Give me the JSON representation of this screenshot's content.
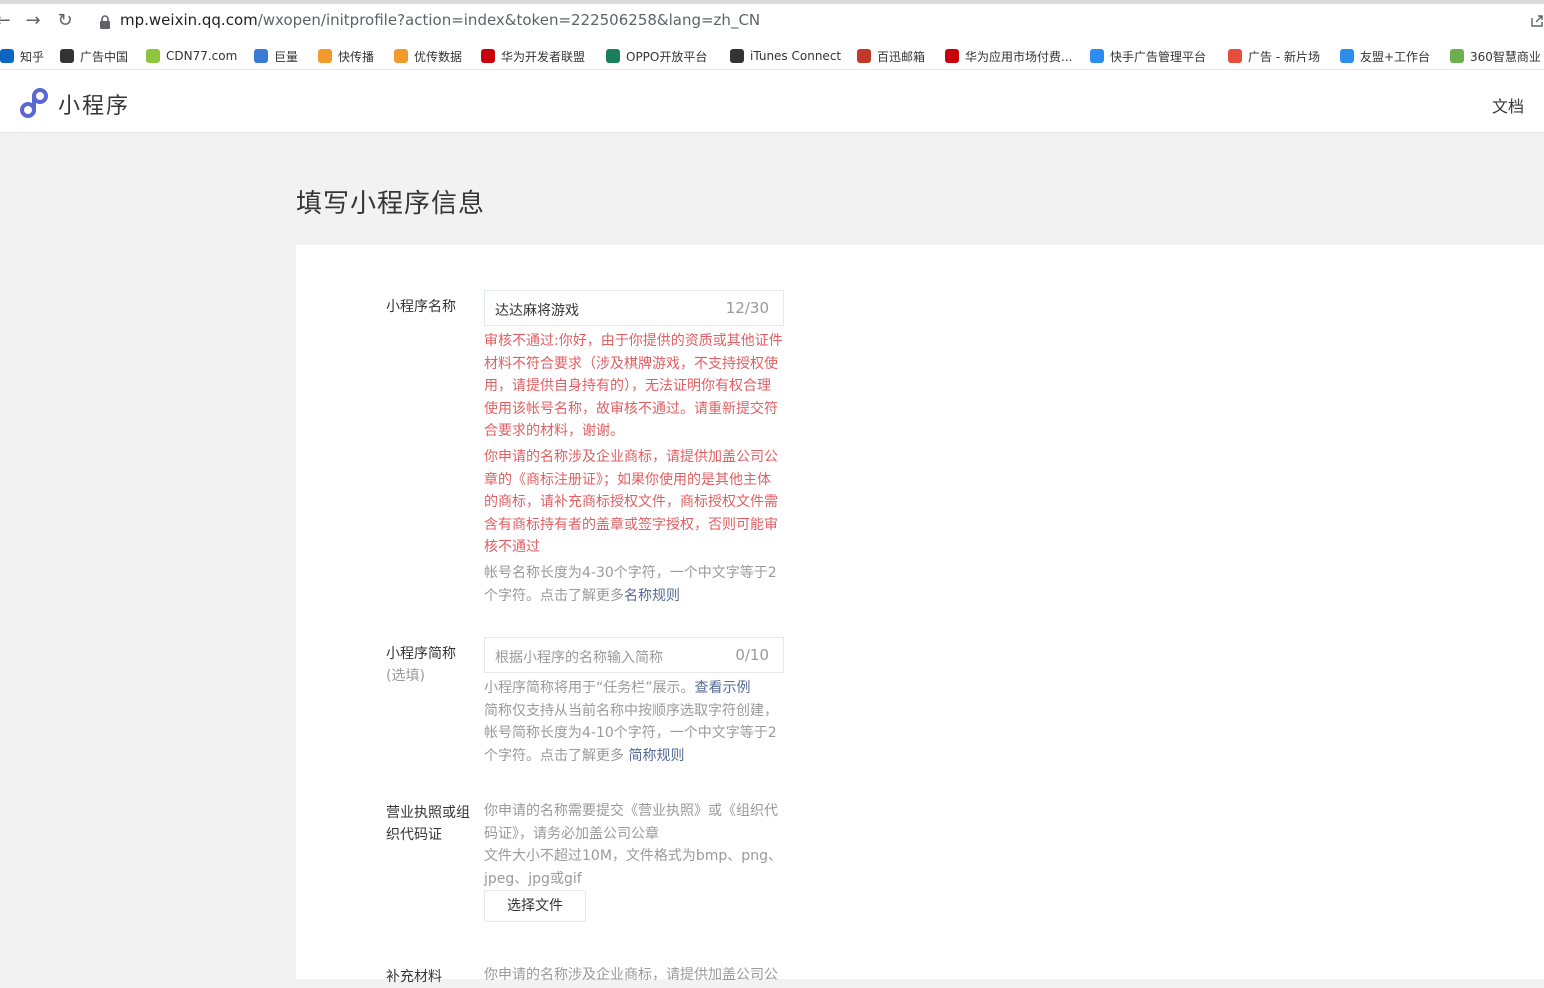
{
  "browser": {
    "url_host": "mp.weixin.qq.com",
    "url_path": "/wxopen/initprofile?action=index&token=222506258&lang=zh_CN",
    "bookmarks": [
      {
        "label": "知乎",
        "icon": "zhihu-icon",
        "color": "#0a66c2"
      },
      {
        "label": "广告中国",
        "icon": "ad-china-icon",
        "color": "#333333"
      },
      {
        "label": "CDN77.com",
        "icon": "cdn77-icon",
        "color": "#8cc63f"
      },
      {
        "label": "巨量",
        "icon": "juliang-icon",
        "color": "#3a7bd5"
      },
      {
        "label": "快传播",
        "icon": "kuaichuanbo-icon",
        "color": "#f29a2e"
      },
      {
        "label": "优传数据",
        "icon": "youchuan-icon",
        "color": "#f29a2e"
      },
      {
        "label": "华为开发者联盟",
        "icon": "huawei-icon",
        "color": "#c7000b"
      },
      {
        "label": "OPPO开放平台",
        "icon": "oppo-icon",
        "color": "#1a7f5a"
      },
      {
        "label": "iTunes Connect",
        "icon": "apple-icon",
        "color": "#333333"
      },
      {
        "label": "百迅邮箱",
        "icon": "mail-icon",
        "color": "#c0392b"
      },
      {
        "label": "华为应用市场付费...",
        "icon": "huawei-icon",
        "color": "#c7000b"
      },
      {
        "label": "快手广告管理平台",
        "icon": "kuaishou-icon",
        "color": "#2d8cf0"
      },
      {
        "label": "广告 - 新片场",
        "icon": "xinpianchang-icon",
        "color": "#e74c3c"
      },
      {
        "label": "友盟+工作台",
        "icon": "umeng-icon",
        "color": "#2d8cf0"
      },
      {
        "label": "360智慧商业",
        "icon": "360-icon",
        "color": "#6ab04c"
      }
    ]
  },
  "header": {
    "logo_text": "小程序",
    "docs": "文档"
  },
  "page": {
    "title": "填写小程序信息"
  },
  "form": {
    "name": {
      "label": "小程序名称",
      "value": "达达麻将游戏",
      "counter": "12/30",
      "error1": "审核不通过:你好，由于你提供的资质或其他证件材料不符合要求（涉及棋牌游戏，不支持授权使用，请提供自身持有的），无法证明你有权合理使用该帐号名称，故审核不通过。请重新提交符合要求的材料，谢谢。",
      "error2": "你申请的名称涉及企业商标，请提供加盖公司公章的《商标注册证》；如果你使用的是其他主体的商标，请补充商标授权文件，商标授权文件需含有商标持有者的盖章或签字授权，否则可能审核不通过",
      "tip": "帐号名称长度为4-30个字符，一个中文字等于2个字符。点击了解更多",
      "tip_link": "名称规则"
    },
    "short_name": {
      "label": "小程序简称",
      "label_sub": "(选填)",
      "placeholder": "根据小程序的名称输入简称",
      "counter": "0/10",
      "tip1": "小程序简称将用于“任务栏”展示。",
      "tip1_link": "查看示例",
      "tip2": "简称仅支持从当前名称中按顺序选取字符创建，帐号简称长度为4-10个字符，一个中文字等于2个字符。点击了解更多 ",
      "tip2_link": "简称规则"
    },
    "license": {
      "label": "营业执照或组织代码证",
      "tip1": "你申请的名称需要提交《营业执照》或《组织代码证》，请务必加盖公司公章",
      "tip2": "文件大小不超过10M，文件格式为bmp、png、jpeg、jpg或gif",
      "button": "选择文件"
    },
    "supplement": {
      "label": "补充材料",
      "tip": "你申请的名称涉及企业商标，请提供加盖公司公"
    }
  }
}
